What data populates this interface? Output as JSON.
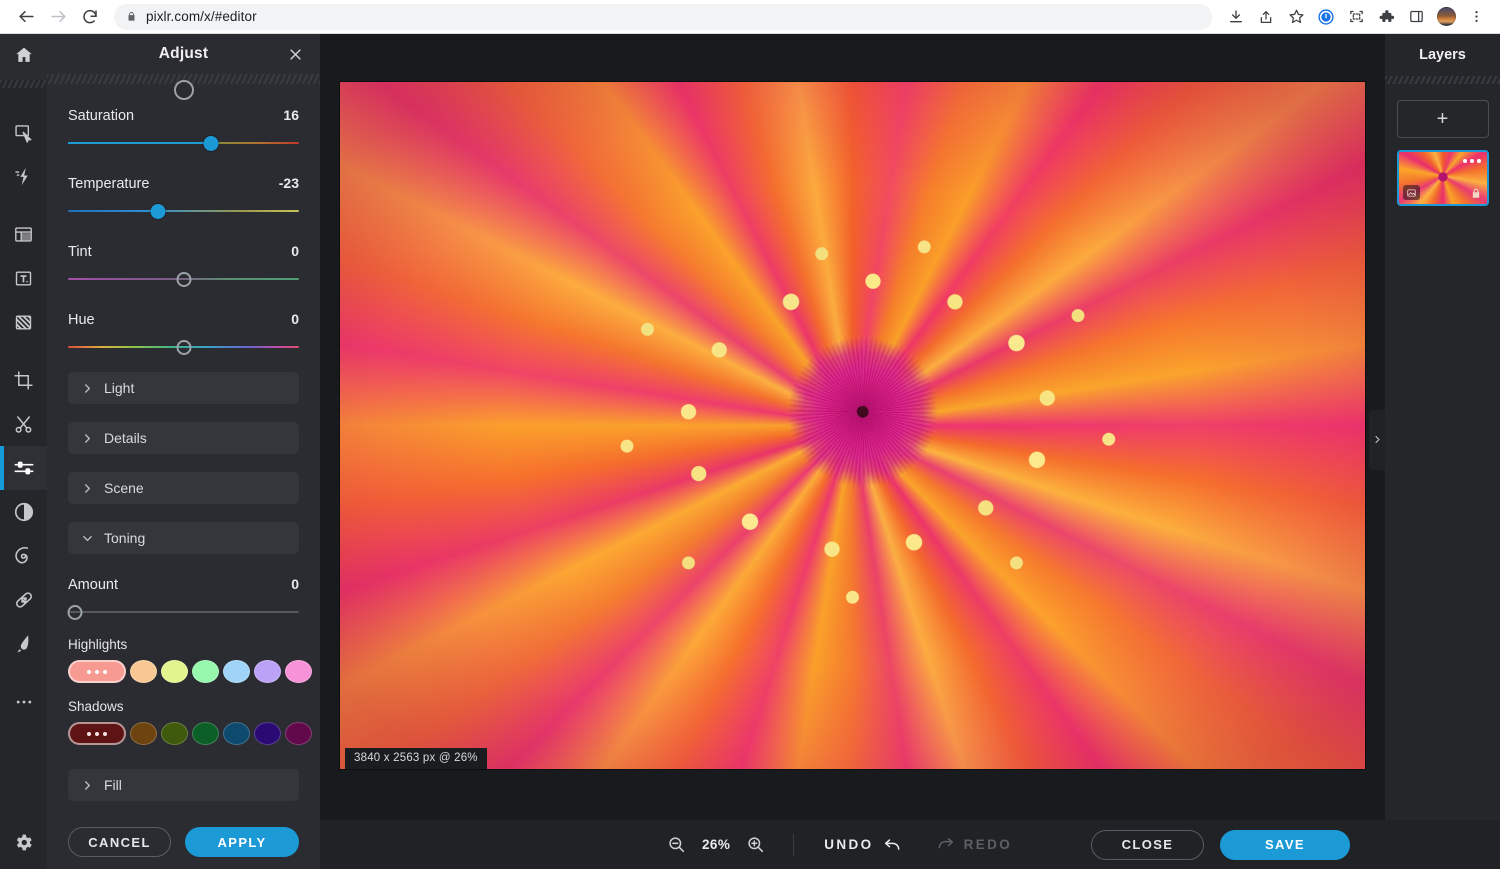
{
  "browser": {
    "url": "pixlr.com/x/#editor",
    "nav": {
      "back": "Back",
      "forward": "Forward",
      "reload": "Reload"
    },
    "icons": [
      "download-icon",
      "share-icon",
      "bookmark-star-icon",
      "password-manager-icon",
      "screen-capture-icon",
      "extensions-puzzle-icon",
      "side-panel-icon",
      "profile-avatar",
      "browser-menu-icon"
    ]
  },
  "toolbar": {
    "home_label": "Home",
    "tools": [
      {
        "name": "arrange-tool",
        "label": "Arrange"
      },
      {
        "name": "quick-effects-tool",
        "label": "Effects"
      },
      {
        "name": "layout-tool",
        "label": "Layout"
      },
      {
        "name": "text-tool",
        "label": "Text"
      },
      {
        "name": "pattern-tool",
        "label": "Pattern"
      },
      {
        "name": "crop-tool",
        "label": "Crop"
      },
      {
        "name": "cutout-tool",
        "label": "Cutout"
      },
      {
        "name": "adjust-tool",
        "label": "Adjust",
        "active": true
      },
      {
        "name": "filter-tool",
        "label": "Filter"
      },
      {
        "name": "liquify-tool",
        "label": "Liquify"
      },
      {
        "name": "retouch-tool",
        "label": "Retouch"
      },
      {
        "name": "draw-tool",
        "label": "Draw"
      },
      {
        "name": "more-tools",
        "label": "More"
      }
    ],
    "settings_label": "Settings"
  },
  "panel": {
    "title": "Adjust",
    "close_label": "×",
    "sliders": [
      {
        "label": "Saturation",
        "value": "16",
        "pct": 62,
        "style": "sat",
        "knob": "filled"
      },
      {
        "label": "Temperature",
        "value": "-23",
        "pct": 39,
        "style": "temp",
        "knob": "filled"
      },
      {
        "label": "Tint",
        "value": "0",
        "pct": 50,
        "style": "tint",
        "knob": "hollow"
      },
      {
        "label": "Hue",
        "value": "0",
        "pct": 50,
        "style": "hue",
        "knob": "hollow"
      }
    ],
    "sections": [
      {
        "label": "Light",
        "expanded": false
      },
      {
        "label": "Details",
        "expanded": false
      },
      {
        "label": "Scene",
        "expanded": false
      },
      {
        "label": "Toning",
        "expanded": true
      }
    ],
    "toning": {
      "amount_label": "Amount",
      "amount_value": "0",
      "amount_pct": 0,
      "highlights_label": "Highlights",
      "highlights": [
        "#f79a92",
        "#f8c894",
        "#e1f58f",
        "#97f7ad",
        "#9fd4f8",
        "#bba2f7",
        "#f892d8"
      ],
      "shadows_label": "Shadows",
      "shadows": [
        "#5e1414",
        "#6d4410",
        "#3f5a0c",
        "#0c5e27",
        "#0e4a6d",
        "#2a0b73",
        "#61094b"
      ]
    },
    "fill_section": {
      "label": "Fill",
      "expanded": false
    },
    "cancel_label": "CANCEL",
    "apply_label": "APPLY"
  },
  "canvas": {
    "size_chip": "3840 x 2563 px @ 26%",
    "collapse_label": "›"
  },
  "layers": {
    "title": "Layers",
    "add_label": "+",
    "item": {
      "menu_label": "Layer options",
      "type_icon": "image-icon",
      "lock_icon": "lock-icon"
    }
  },
  "bottom": {
    "zoom_out_label": "Zoom out",
    "zoom_value": "26%",
    "zoom_in_label": "Zoom in",
    "undo_label": "UNDO",
    "redo_label": "REDO",
    "close_label": "CLOSE",
    "save_label": "SAVE"
  },
  "colors": {
    "accent": "#1b9ad6",
    "panel_bg": "#2b2c31",
    "rail_bg": "#25262a",
    "stage_bg": "#191a1d"
  }
}
